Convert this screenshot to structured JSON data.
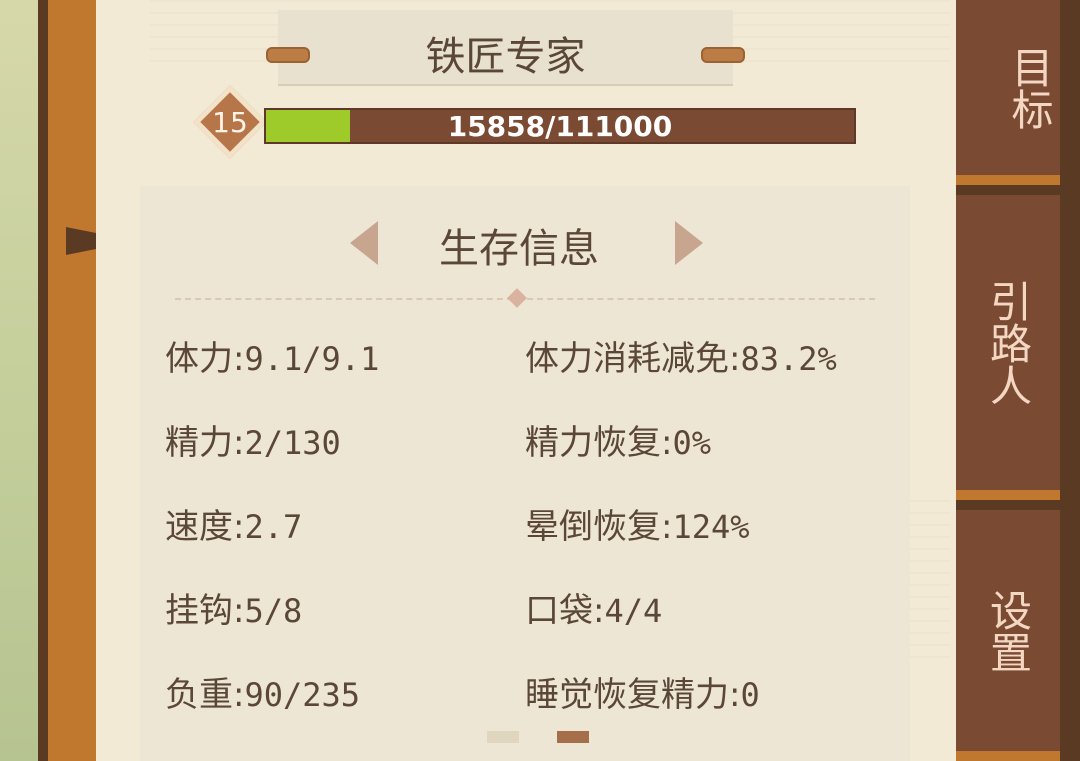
{
  "header": {
    "title": "铁匠专家"
  },
  "level": {
    "value": "15",
    "xp_text": "15858/111000",
    "progress": 0.1429
  },
  "info_panel": {
    "section_title": "生存信息",
    "stats_left": [
      {
        "label": "体力:",
        "value": "9.1/9.1"
      },
      {
        "label": "精力:",
        "value": "2/130"
      },
      {
        "label": "速度:",
        "value": "2.7"
      },
      {
        "label": "挂钩:",
        "value": "5/8"
      },
      {
        "label": "负重:",
        "value": "90/235"
      }
    ],
    "stats_right": [
      {
        "label": "体力消耗减免:",
        "value": "83.2%"
      },
      {
        "label": "精力恢复:",
        "value": "0%"
      },
      {
        "label": "晕倒恢复:",
        "value": "124%"
      },
      {
        "label": "口袋:",
        "value": "4/4"
      },
      {
        "label": "睡觉恢复精力:",
        "value": "0"
      }
    ],
    "page_indicators": {
      "count": 2,
      "active_index": 1
    }
  },
  "side_tabs": {
    "goal": "目标",
    "guide": "引路人",
    "settings": "设置"
  },
  "colors": {
    "xp_fill": "#9fcb2a",
    "xp_bar": "#7a4a32",
    "tab_bg": "#7a4a32",
    "frame": "#c0782f",
    "page": "#f3ead6"
  }
}
